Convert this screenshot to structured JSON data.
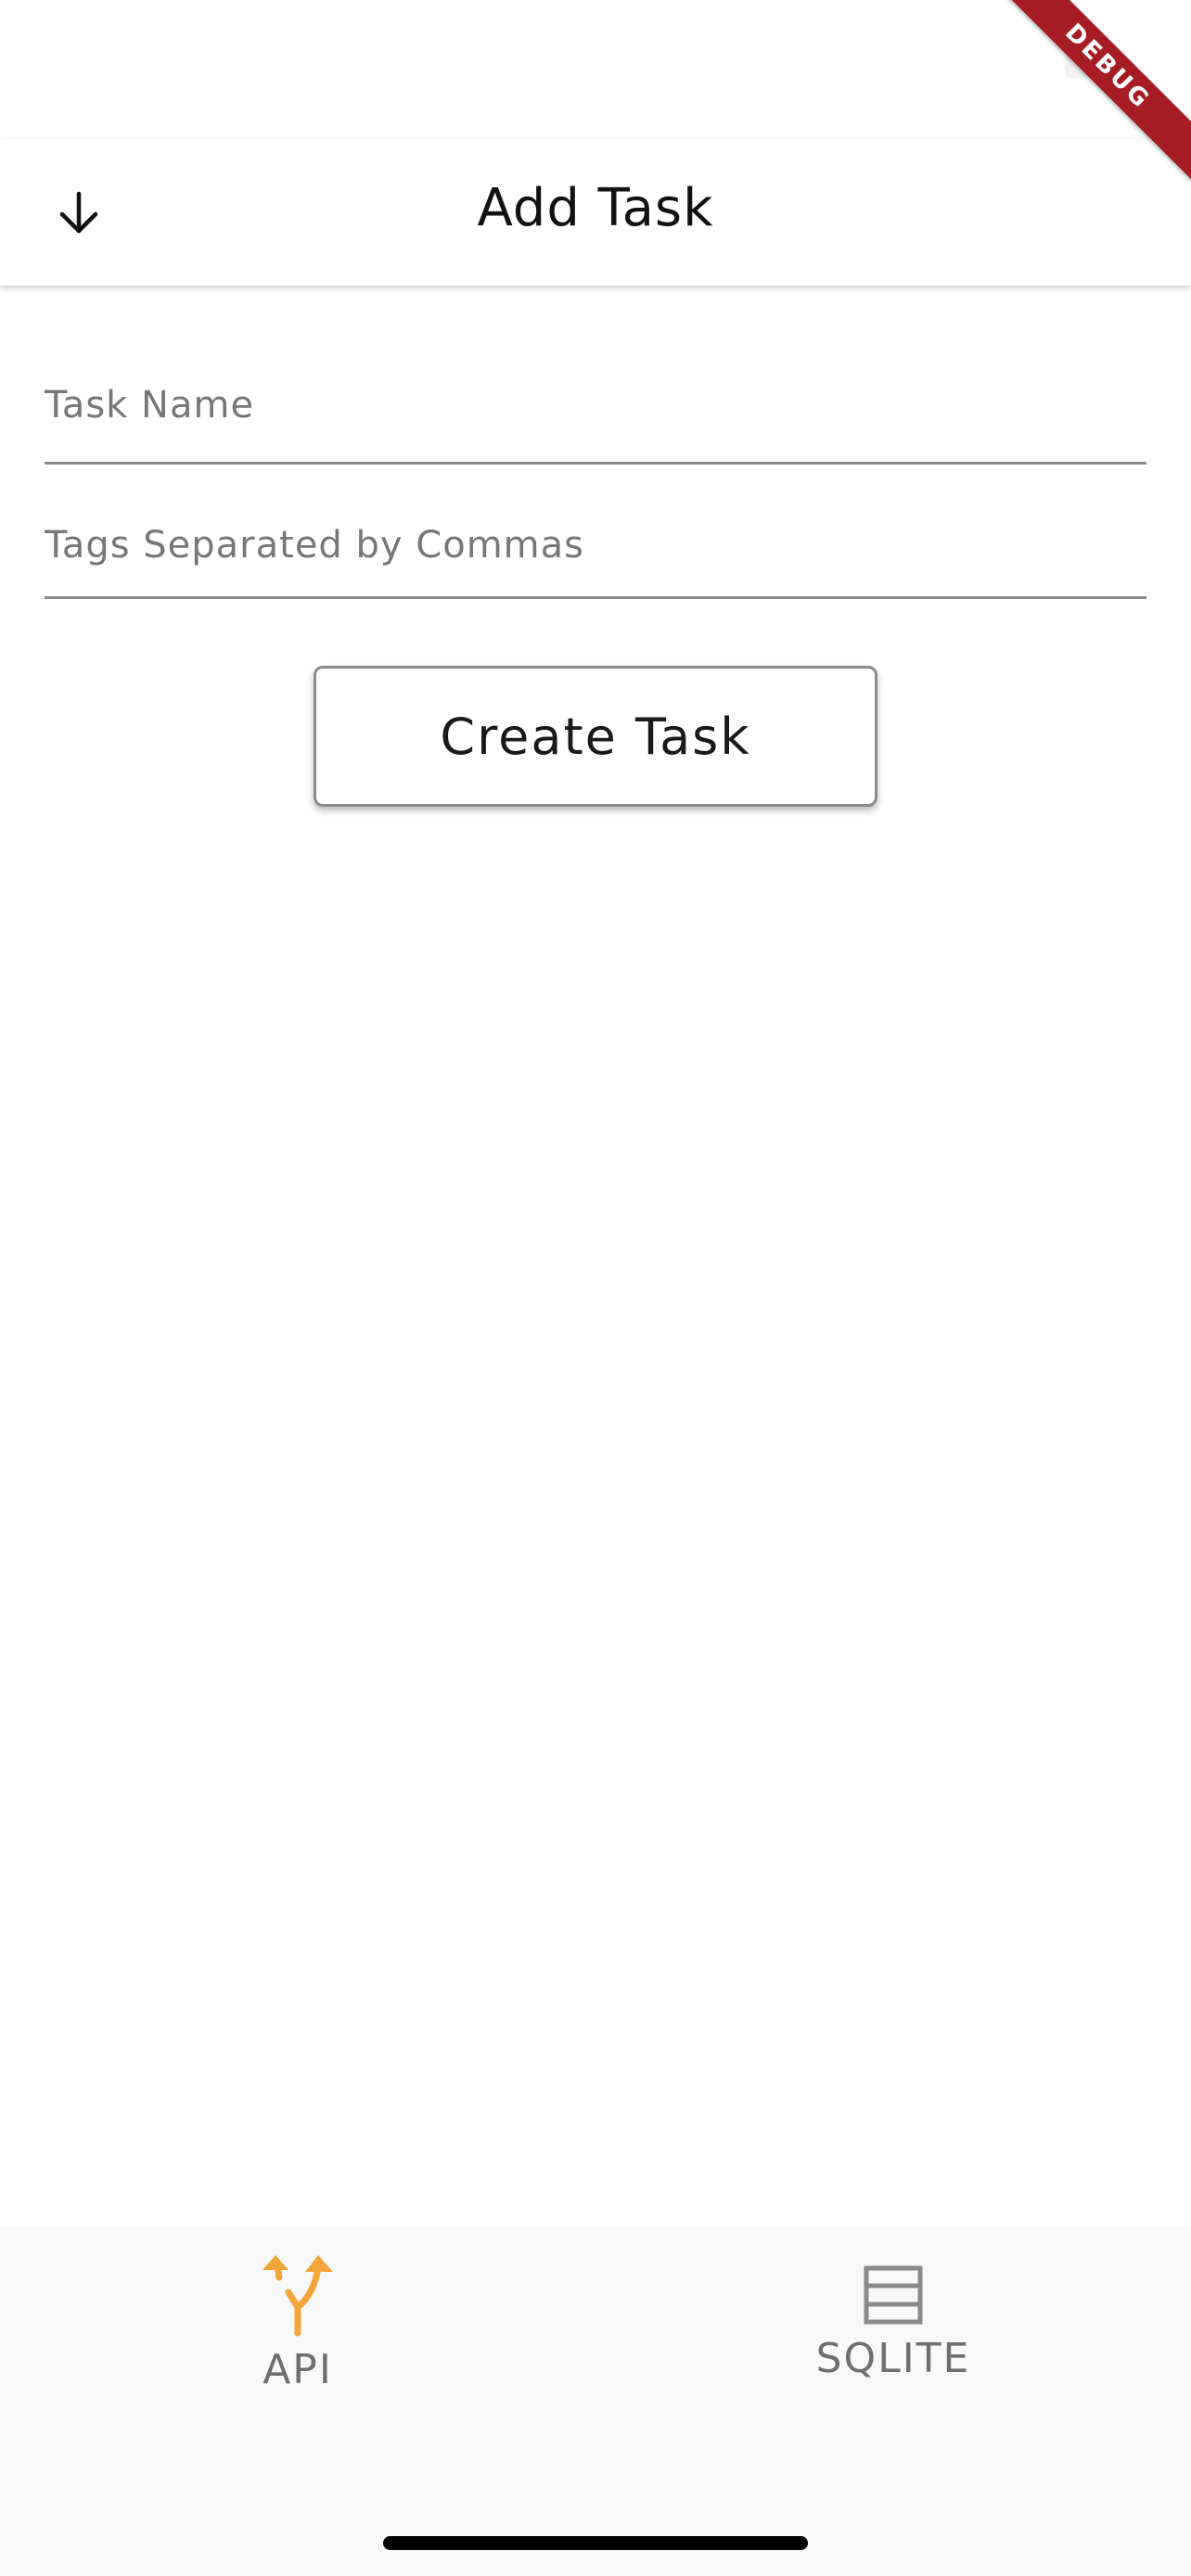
{
  "app_bar": {
    "title": "Add Task",
    "back_icon": "arrow-down-icon"
  },
  "form": {
    "task_name": {
      "value": "",
      "placeholder": "Task Name"
    },
    "tags": {
      "value": "",
      "placeholder": "Tags Separated by Commas"
    },
    "submit_label": "Create Task"
  },
  "bottom_nav": {
    "items": [
      {
        "label": "API",
        "icon": "fork-icon",
        "active": true,
        "color": "#f4a53a"
      },
      {
        "label": "SQLITE",
        "icon": "database-icon",
        "active": false,
        "color": "#8a8a8a"
      }
    ]
  },
  "debug_banner": {
    "label": "DEBUG",
    "color": "#a51d22"
  }
}
